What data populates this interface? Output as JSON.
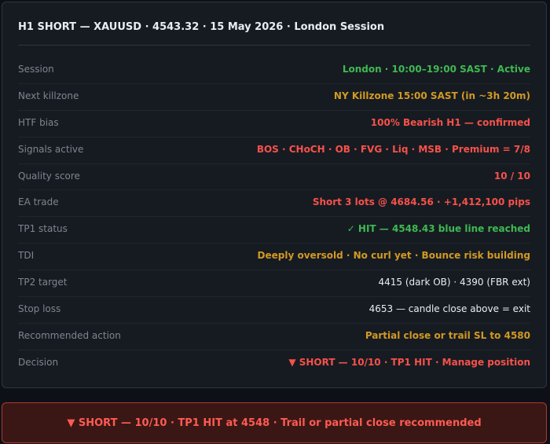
{
  "title": "H1 SHORT — XAUUSD · 4543.32 · 15 May 2026 · London Session",
  "rows": [
    {
      "label": "Session",
      "value": "London · 10:00–19:00 SAST · Active",
      "color": "#3fb950"
    },
    {
      "label": "Next killzone",
      "value": "NY Killzone 15:00 SAST (in ~3h 20m)",
      "color": "#d29922"
    },
    {
      "label": "HTF bias",
      "value": "100% Bearish H1 — confirmed",
      "color": "#f85149"
    },
    {
      "label": "Signals active",
      "value": "BOS · CHoCH · OB · FVG · Liq · MSB · Premium = 7/8",
      "color": "#f85149"
    },
    {
      "label": "Quality score",
      "value": "10 / 10",
      "color": "#f85149"
    },
    {
      "label": "EA trade",
      "value": "Short 3 lots @ 4684.56 · +1,412,100 pips",
      "color": "#f85149"
    },
    {
      "label": "TP1 status",
      "value": "✓ HIT — 4548.43 blue line reached",
      "color": "#3fb950"
    },
    {
      "label": "TDI",
      "value": "Deeply oversold · No curl yet · Bounce risk building",
      "color": "#d29922"
    },
    {
      "label": "TP2 target",
      "value": "4415 (dark OB) · 4390 (FBR ext)",
      "color": "#e6edf3"
    },
    {
      "label": "Stop loss",
      "value": "4653 — candle close above = exit",
      "color": "#e6edf3"
    },
    {
      "label": "Recommended action",
      "value": "Partial close or trail SL to 4580",
      "color": "#d29922"
    },
    {
      "label": "Decision",
      "value": "▼ SHORT — 10/10 · TP1 HIT · Manage position",
      "color": "#f85149"
    }
  ],
  "banner": "▼ SHORT — 10/10 · TP1 HIT at 4548 · Trail or partial close recommended"
}
